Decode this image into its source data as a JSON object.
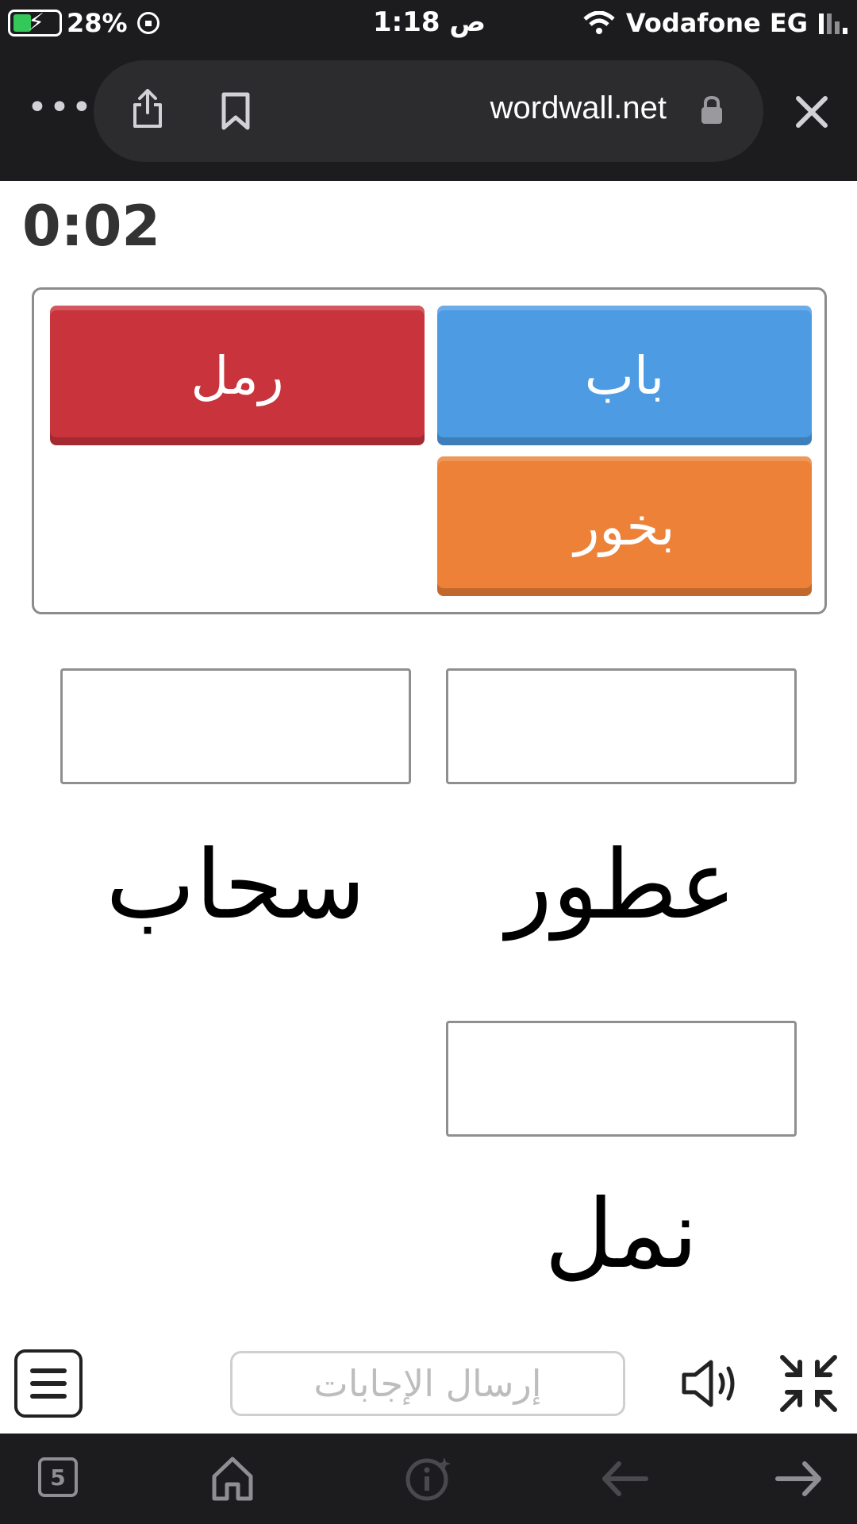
{
  "status_bar": {
    "battery_percent": "28%",
    "time": "1:18 ص",
    "carrier": "Vodafone EG"
  },
  "browser": {
    "host": "wordwall.net",
    "tab_count": "5"
  },
  "game": {
    "timer": "0:02",
    "tiles": [
      {
        "label": "رمل",
        "color": "#c9333c"
      },
      {
        "label": "باب",
        "color": "#4c9be3"
      },
      {
        "label": "بخور",
        "color": "#ec8137"
      }
    ],
    "targets": [
      {
        "word": "سحاب",
        "filled": ""
      },
      {
        "word": "عطور",
        "filled": ""
      },
      {
        "word": "نمل",
        "filled": ""
      }
    ],
    "submit_label": "إرسال الإجابات"
  },
  "icons": [
    "battery-icon",
    "orientation-lock-icon",
    "wifi-icon",
    "signal-icon",
    "more-icon",
    "share-icon",
    "bookmark-icon",
    "lock-icon",
    "close-icon",
    "menu-icon",
    "sound-icon",
    "exit-fullscreen-icon",
    "tabs-icon",
    "home-icon",
    "info-icon",
    "back-arrow-icon",
    "forward-arrow-icon"
  ]
}
